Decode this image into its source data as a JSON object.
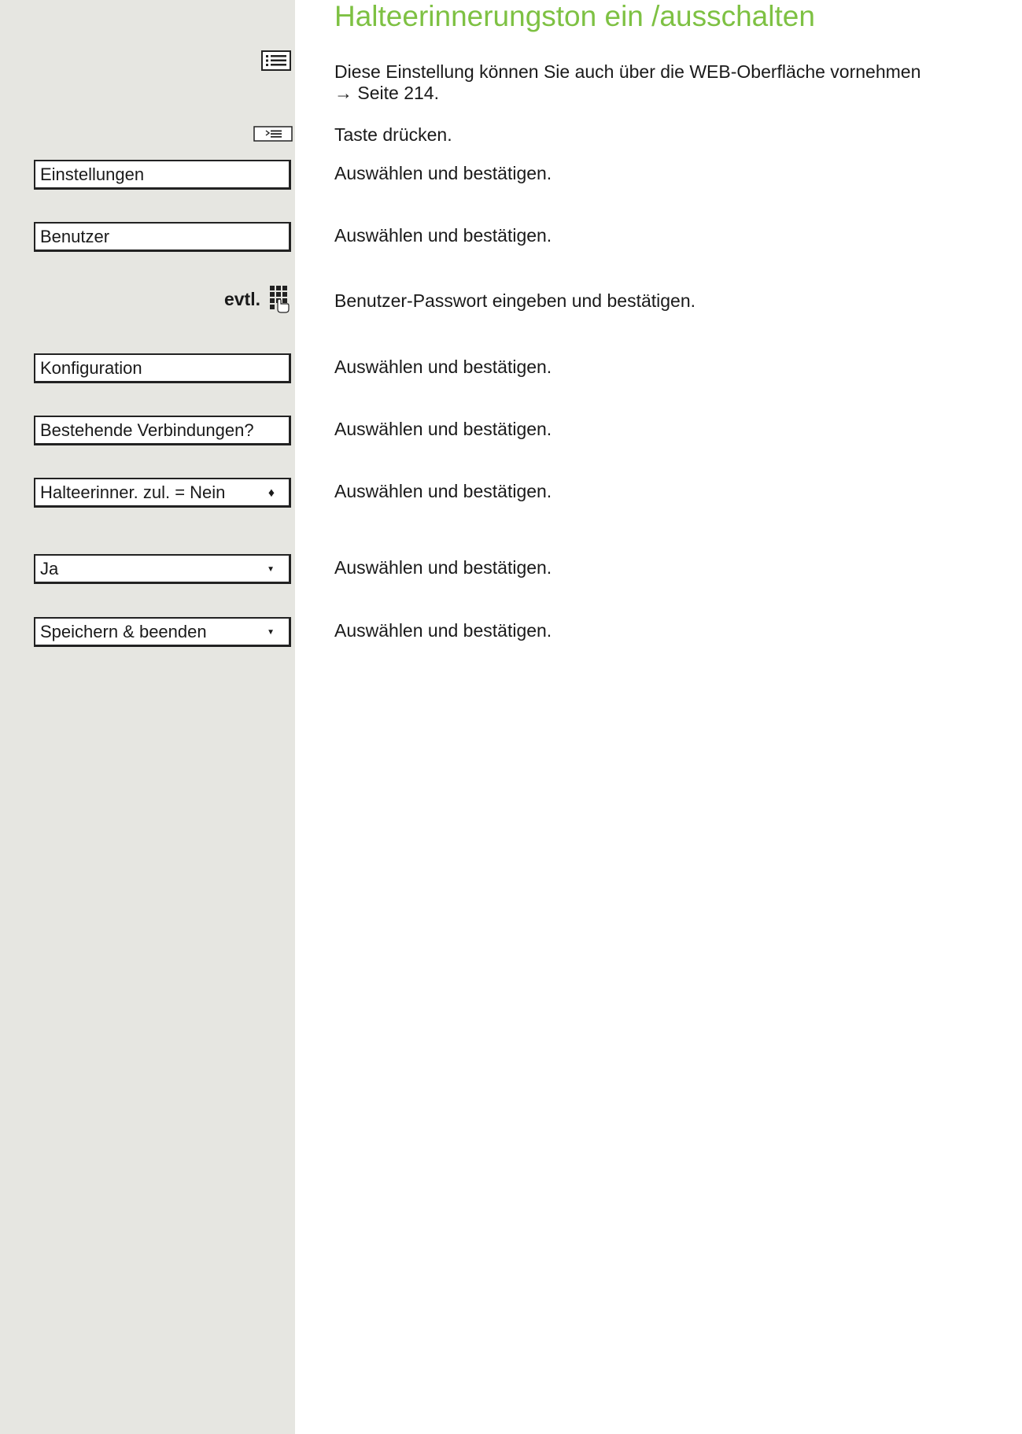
{
  "title": "Halteerinnerungston ein /ausschalten",
  "note": {
    "line1": "Diese Einstellung können Sie auch über die WEB-Oberfläche vornehmen",
    "line2": "→ Seite 214."
  },
  "icons": {
    "web_settings": "web-settings-icon",
    "menu_key": "menu-key-icon",
    "keypad": "keypad-icon"
  },
  "optional_label": "evtl.",
  "steps": [
    {
      "menu": "",
      "text": "Taste drücken."
    },
    {
      "menu": "Einstellungen",
      "text": "Auswählen und bestätigen."
    },
    {
      "menu": "Benutzer",
      "text": "Auswählen und bestätigen."
    },
    {
      "menu": "",
      "text": "Benutzer-Passwort eingeben und bestätigen."
    },
    {
      "menu": "Konfiguration",
      "text": "Auswählen und bestätigen."
    },
    {
      "menu": "Bestehende Verbindungen?",
      "text": "Auswählen und bestätigen."
    },
    {
      "menu": "Halteerinner. zul. = Nein",
      "text": "Auswählen und bestätigen.",
      "arrow": "updown"
    },
    {
      "menu": "Ja",
      "text": "Auswählen und bestätigen.",
      "arrow": "down"
    },
    {
      "menu": "Speichern & beenden",
      "text": "Auswählen und bestätigen.",
      "arrow": "down"
    }
  ],
  "arrows": {
    "updown": "♦",
    "down": "▼"
  }
}
